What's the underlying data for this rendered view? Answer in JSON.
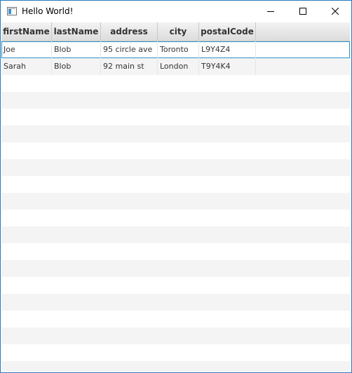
{
  "window": {
    "title": "Hello World!",
    "accent": "#2b7bb9"
  },
  "table": {
    "columns": [
      "firstName",
      "lastName",
      "address",
      "city",
      "postalCode"
    ],
    "rows": [
      [
        "Joe",
        "Blob",
        "95 circle ave",
        "Toronto",
        "L9Y4Z4"
      ],
      [
        "Sarah",
        "Blob",
        "92 main st",
        "London",
        "T9Y4K4"
      ]
    ],
    "selected_row": 0,
    "selection_color": "#2b94c2",
    "stripe_color": "#f4f4f4"
  },
  "icons": {
    "app": "app-window-icon",
    "minimize": "minimize-icon",
    "maximize": "maximize-icon",
    "close": "close-icon"
  }
}
